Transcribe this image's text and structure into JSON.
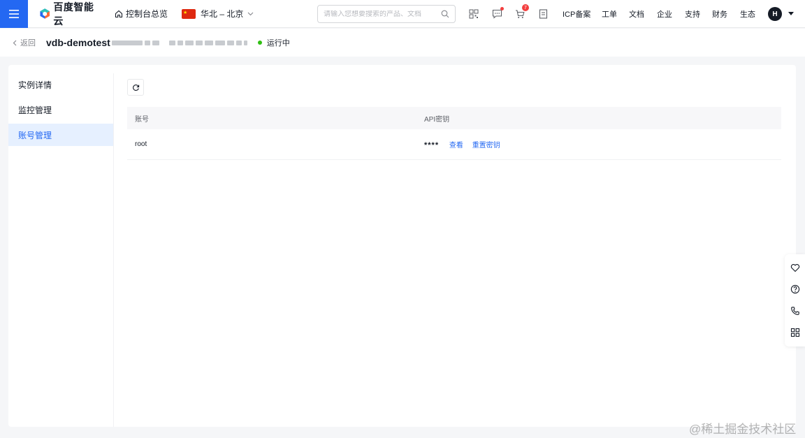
{
  "brand": {
    "name": "百度智能云"
  },
  "topnav": {
    "console_home": "控制台总览",
    "region": "华北 – 北京",
    "search_placeholder": "请输入您想要搜索的产品、文档",
    "cart_badge": "7",
    "links": [
      "ICP备案",
      "工单",
      "文档",
      "企业",
      "支持",
      "财务",
      "生态"
    ],
    "avatar_initial": "H"
  },
  "subheader": {
    "back_label": "返回",
    "instance_name": "vdb-demotest",
    "status_label": "运行中",
    "status_color": "#30bf13"
  },
  "sidebar": {
    "items": [
      {
        "label": "实例详情",
        "active": false
      },
      {
        "label": "监控管理",
        "active": false
      },
      {
        "label": "账号管理",
        "active": true
      }
    ]
  },
  "accounts": {
    "columns": [
      "账号",
      "API密钥"
    ],
    "rows": [
      {
        "account": "root",
        "api_key_masked": "****",
        "view_label": "查看",
        "reset_label": "重置密钥"
      }
    ]
  },
  "watermark": "@稀土掘金技术社区",
  "colors": {
    "primary": "#2468f2",
    "badge": "#f33e3e"
  }
}
